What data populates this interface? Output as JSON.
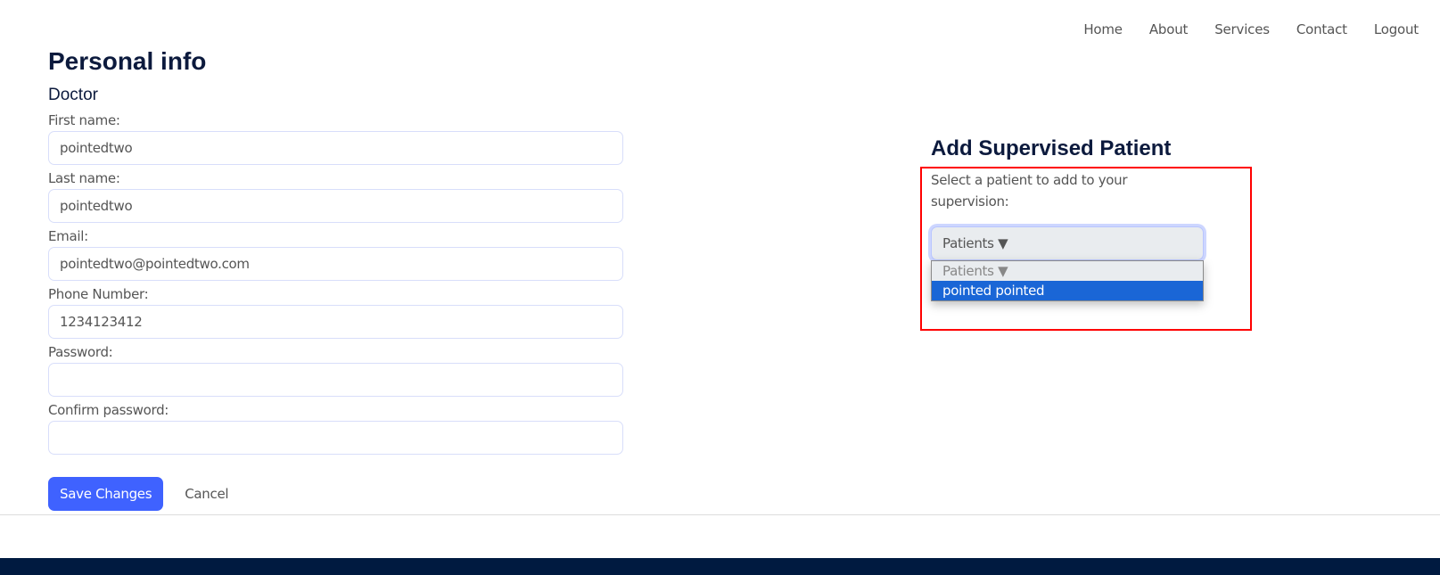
{
  "nav": {
    "items": [
      {
        "label": "Home"
      },
      {
        "label": "About"
      },
      {
        "label": "Services"
      },
      {
        "label": "Contact"
      },
      {
        "label": "Logout"
      }
    ]
  },
  "profile": {
    "title": "Personal info",
    "role": "Doctor",
    "fields": [
      {
        "label": "First name:",
        "value": "pointedtwo"
      },
      {
        "label": "Last name:",
        "value": "pointedtwo"
      },
      {
        "label": "Email:",
        "value": "pointedtwo@pointedtwo.com"
      },
      {
        "label": "Phone Number:",
        "value": "1234123412"
      },
      {
        "label": "Password:",
        "value": ""
      },
      {
        "label": "Confirm password:",
        "value": ""
      }
    ],
    "save_label": "Save Changes",
    "cancel_label": "Cancel"
  },
  "supervision": {
    "title": "Add Supervised Patient",
    "prompt": "Select a patient to add to your supervision:",
    "select_value": "Patients ▼",
    "options": [
      {
        "label": "Patients ▼"
      },
      {
        "label": "pointed pointed"
      }
    ],
    "highlight_color": "#ff0000",
    "selected_option_color": "#1a66d6"
  },
  "colors": {
    "primary_button": "#3f62ff",
    "heading": "#0c1a3d",
    "footer": "#001a40"
  }
}
